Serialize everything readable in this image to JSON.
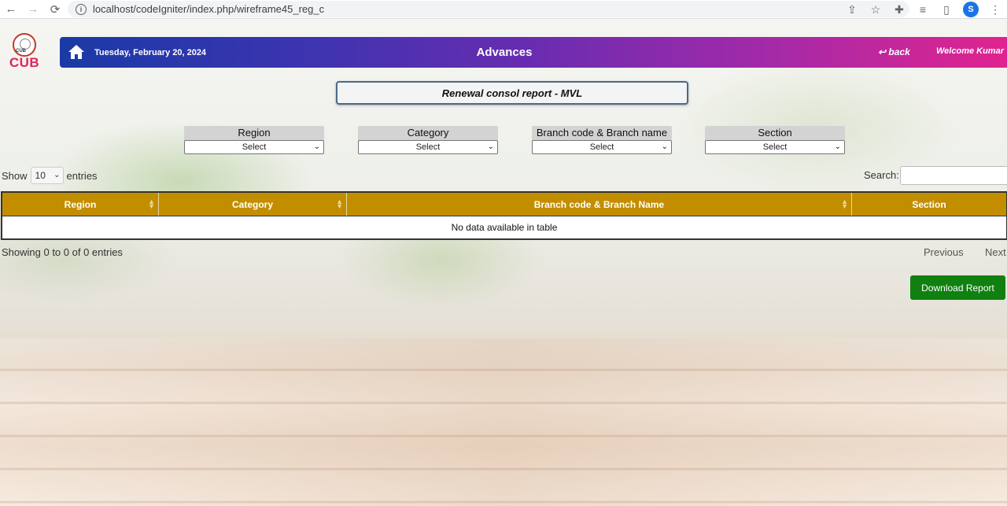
{
  "browser": {
    "url": "localhost/codeIgniter/index.php/wireframe45_reg_c",
    "avatar_letter": "S"
  },
  "logo": {
    "text": "CUB",
    "small_text": "CUB"
  },
  "header": {
    "date": "Tuesday, February 20, 2024",
    "title": "Advances",
    "back_label": "back",
    "back_icon": "↩",
    "welcome": "Welcome Kumar"
  },
  "report_title": "Renewal consol report - MVL",
  "filters": [
    {
      "label": "Region",
      "value": "Select"
    },
    {
      "label": "Category",
      "value": "Select"
    },
    {
      "label": "Branch code & Branch name",
      "value": "Select"
    },
    {
      "label": "Section",
      "value": "Select"
    }
  ],
  "table_controls": {
    "show_label": "Show",
    "page_length": "10",
    "entries_label": "entries",
    "search_label": "Search:"
  },
  "table": {
    "columns": [
      "Region",
      "Category",
      "Branch code & Branch Name",
      "Section"
    ],
    "empty_message": "No data available in table",
    "info": "Showing 0 to 0 of 0 entries",
    "previous": "Previous",
    "next": "Next"
  },
  "download_label": "Download Report",
  "colors": {
    "header_start": "#1a3aa6",
    "header_end": "#e0248f",
    "table_header": "#c28e00",
    "download_button": "#108010",
    "logo": "#e0245e"
  }
}
